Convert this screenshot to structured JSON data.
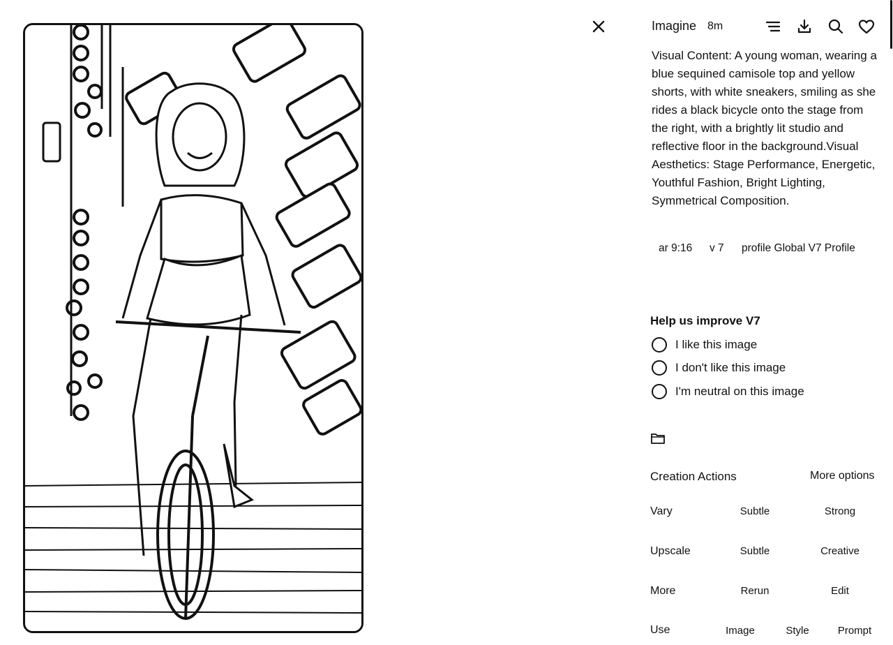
{
  "header": {
    "title": "Imagine",
    "age": "8m",
    "close_icon": "close-icon",
    "icons": [
      "menu-icon",
      "download-icon",
      "search-icon",
      "heart-icon"
    ]
  },
  "image": {
    "icon": "bicycle-rider-sketch-image"
  },
  "prompt": {
    "text": "Visual Content: A young woman, wearing a blue sequined camisole top and yellow shorts, with white sneakers, smiling as she rides a black bicycle onto the stage from the right, with a brightly lit studio and reflective floor in the background.Visual Aesthetics: Stage Performance, Energetic, Youthful Fashion, Bright Lighting, Symmetrical Composition."
  },
  "params": {
    "aspect": "ar 9:16",
    "version": "v 7",
    "profile": "profile Global V7 Profile"
  },
  "feedback": {
    "title": "Help us improve V7",
    "options": [
      "I like this image",
      "I don't like this image",
      "I'm neutral on this image"
    ]
  },
  "folder": {
    "icon": "folder-icon"
  },
  "actions": {
    "title": "Creation Actions",
    "more_options": "More options",
    "vary": {
      "label": "Vary",
      "subtle": "Subtle",
      "strong": "Strong"
    },
    "upscale": {
      "label": "Upscale",
      "subtle": "Subtle",
      "creative": "Creative"
    },
    "more": {
      "label": "More",
      "rerun": "Rerun",
      "edit": "Edit"
    },
    "use": {
      "label": "Use",
      "image": "Image",
      "style": "Style",
      "prompt": "Prompt"
    }
  }
}
